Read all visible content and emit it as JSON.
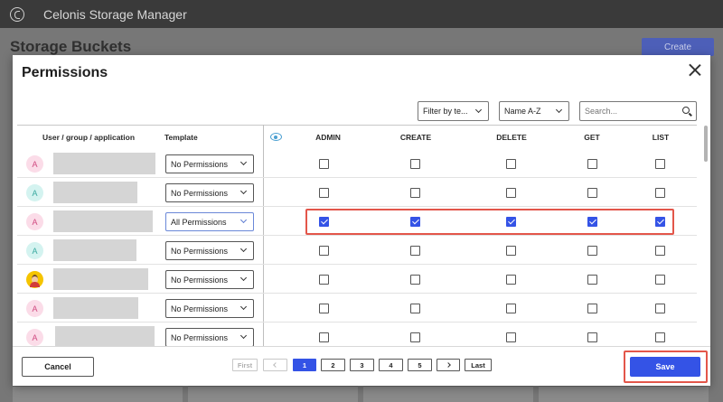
{
  "app": {
    "title": "Celonis Storage Manager",
    "logo_icon": "celonis-logo-icon"
  },
  "page": {
    "title": "Storage Buckets",
    "create_label": "Create"
  },
  "modal": {
    "title": "Permissions",
    "close_icon": "close-icon",
    "filter": {
      "selected": "Filter by te..."
    },
    "sort": {
      "selected": "Name A-Z"
    },
    "search": {
      "placeholder": "Search...",
      "value": ""
    },
    "columns": {
      "user": "User / group / application",
      "template": "Template",
      "permissions": [
        "ADMIN",
        "CREATE",
        "DELETE",
        "GET",
        "LIST"
      ]
    },
    "rows": [
      {
        "avatar_letter": "A",
        "avatar_color": "#fbdce8",
        "template": "No Permissions",
        "checks": [
          false,
          false,
          false,
          false,
          false
        ]
      },
      {
        "avatar_letter": "A",
        "avatar_color": "#d4f3f0",
        "template": "No Permissions",
        "checks": [
          false,
          false,
          false,
          false,
          false
        ]
      },
      {
        "avatar_letter": "A",
        "avatar_color": "#fbdce8",
        "template": "All Permissions",
        "checks": [
          true,
          true,
          true,
          true,
          true
        ]
      },
      {
        "avatar_letter": "A",
        "avatar_color": "#d4f3f0",
        "template": "No Permissions",
        "checks": [
          false,
          false,
          false,
          false,
          false
        ]
      },
      {
        "avatar_letter": "",
        "avatar_color": "#f5c400",
        "template": "No Permissions",
        "checks": [
          false,
          false,
          false,
          false,
          false
        ]
      },
      {
        "avatar_letter": "A",
        "avatar_color": "#fbdce8",
        "template": "No Permissions",
        "checks": [
          false,
          false,
          false,
          false,
          false
        ]
      },
      {
        "avatar_letter": "A",
        "avatar_color": "#fbdce8",
        "template": "No Permissions",
        "checks": [
          false,
          false,
          false,
          false,
          false
        ]
      }
    ],
    "pagination": {
      "first": "First",
      "last": "Last",
      "pages": [
        "1",
        "2",
        "3",
        "4",
        "5"
      ],
      "current": "1"
    },
    "cancel_label": "Cancel",
    "save_label": "Save"
  },
  "colors": {
    "primary": "#3453e6",
    "highlight": "#e3564a",
    "header_bg": "#3a3a3a"
  }
}
